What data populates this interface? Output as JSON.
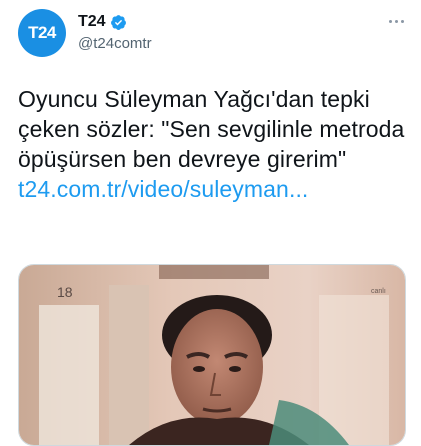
{
  "account": {
    "avatar_text": "T24",
    "display_name": "T24",
    "handle": "@t24comtr",
    "brand_color": "#1a8fe3",
    "verified_color": "#1d9bf0"
  },
  "tweet": {
    "text": "Oyuncu Süleyman Yağcı'dan tepki çeken sözler: \"Sen sevgilinle metroda öpüşürsen ben devreye girerim\"",
    "link_text": "t24.com.tr/video/suleyman...",
    "link_color": "#1d9bf0"
  },
  "media": {
    "corner_left_text": "18",
    "corner_right_text": "canlı"
  },
  "icons": {
    "verified": "verified-badge-icon",
    "more": "more-options-icon"
  }
}
